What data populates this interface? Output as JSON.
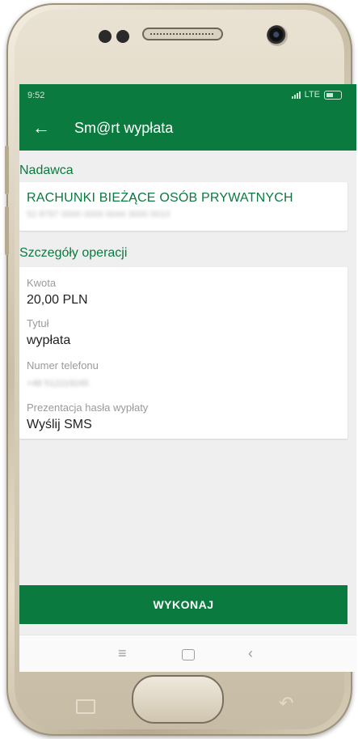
{
  "status_bar": {
    "time": "9:52",
    "network": "LTE",
    "icons": [
      "signal-icon",
      "battery-icon"
    ]
  },
  "app_bar": {
    "back_icon": "arrow-left-icon",
    "title": "Sm@rt wypłata"
  },
  "sender": {
    "section_title": "Nadawca",
    "account_name": "RACHUNKI BIEŻĄCE OSÓB PRYWATNYCH",
    "account_number": "52 8787 0000 0000 0044 3000 0010"
  },
  "details": {
    "section_title": "Szczegóły operacji",
    "fields": [
      {
        "label": "Kwota",
        "value": "20,00 PLN"
      },
      {
        "label": "Tytuł",
        "value": "wypłata"
      },
      {
        "label": "Numer telefonu",
        "value": "+48 512219245"
      },
      {
        "label": "Prezentacja hasła wypłaty",
        "value": "Wyślij SMS"
      }
    ]
  },
  "actions": {
    "execute_label": "WYKONAJ"
  },
  "system_nav": {
    "icons": [
      "menu-icon",
      "home-icon",
      "back-icon"
    ]
  },
  "colors": {
    "brand_green": "#0a7a3e",
    "background": "#efefef",
    "label_gray": "#9a9a9a",
    "value_dark": "#222222"
  }
}
